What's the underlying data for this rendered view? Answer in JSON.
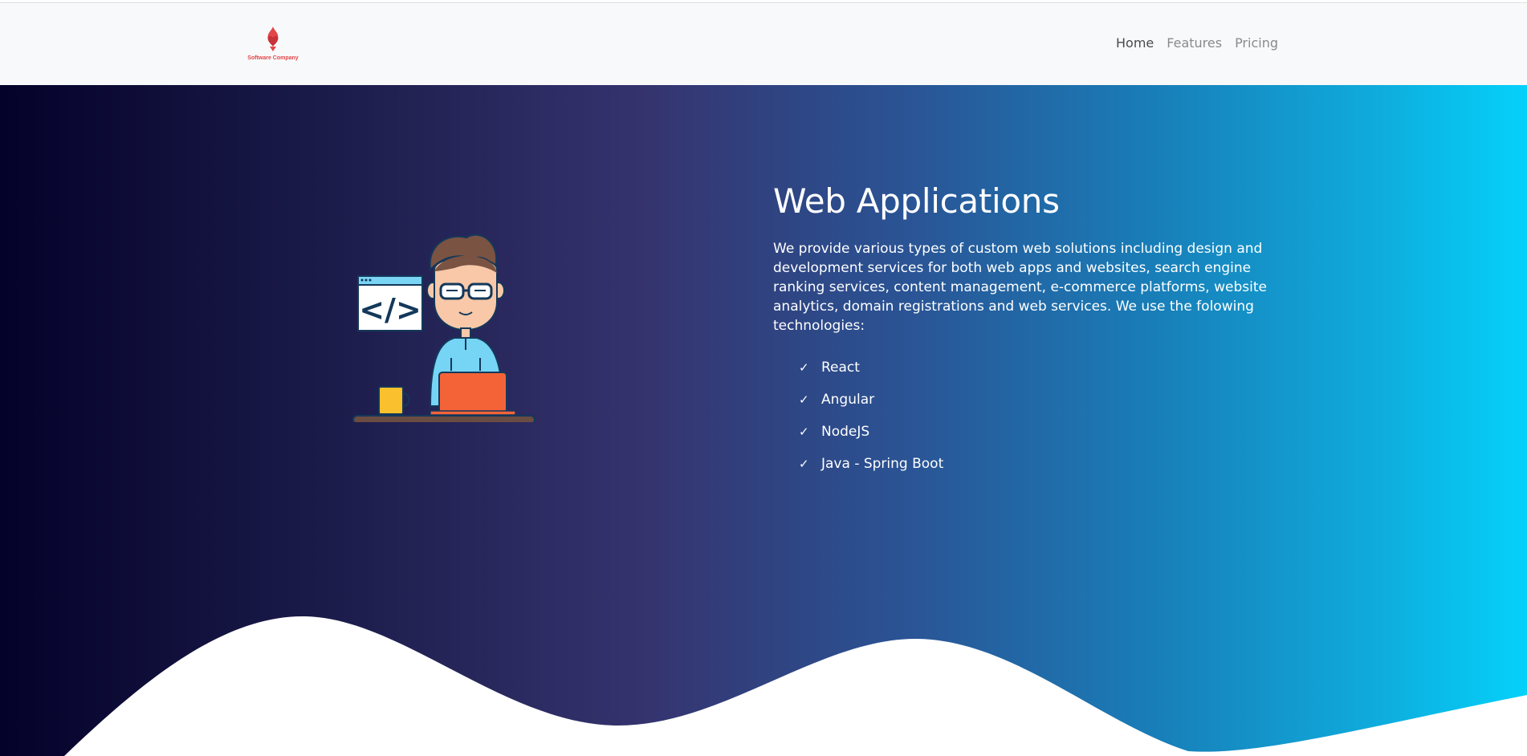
{
  "brand": {
    "name": "Software Company",
    "logo_icon": "flame-heart-icon",
    "color": "#e2474a"
  },
  "nav": {
    "items": [
      {
        "label": "Home",
        "active": true
      },
      {
        "label": "Features",
        "active": false
      },
      {
        "label": "Pricing",
        "active": false
      }
    ]
  },
  "hero": {
    "title": "Web Applications",
    "description": "We provide various types of custom web solutions including design and development services for both web apps and websites, search engine ranking services, content management, e-commerce platforms, website analytics, domain registrations and web services. We use the folowing technologies:",
    "check_icon": "checkmark-icon",
    "technologies": [
      {
        "check": "✓",
        "label": "React"
      },
      {
        "check": "✓",
        "label": "Angular"
      },
      {
        "check": "✓",
        "label": "NodeJS"
      },
      {
        "check": "✓",
        "label": "Java - Spring Boot"
      }
    ],
    "illustration": {
      "icon": "developer-at-laptop-illustration",
      "code_label": "</>"
    }
  },
  "colors": {
    "gradient_start": "#04022a",
    "gradient_mid": "#35336e",
    "gradient_end": "#04d1fa",
    "wave": "#ffffff",
    "navbar_bg": "#f8f9fa"
  }
}
